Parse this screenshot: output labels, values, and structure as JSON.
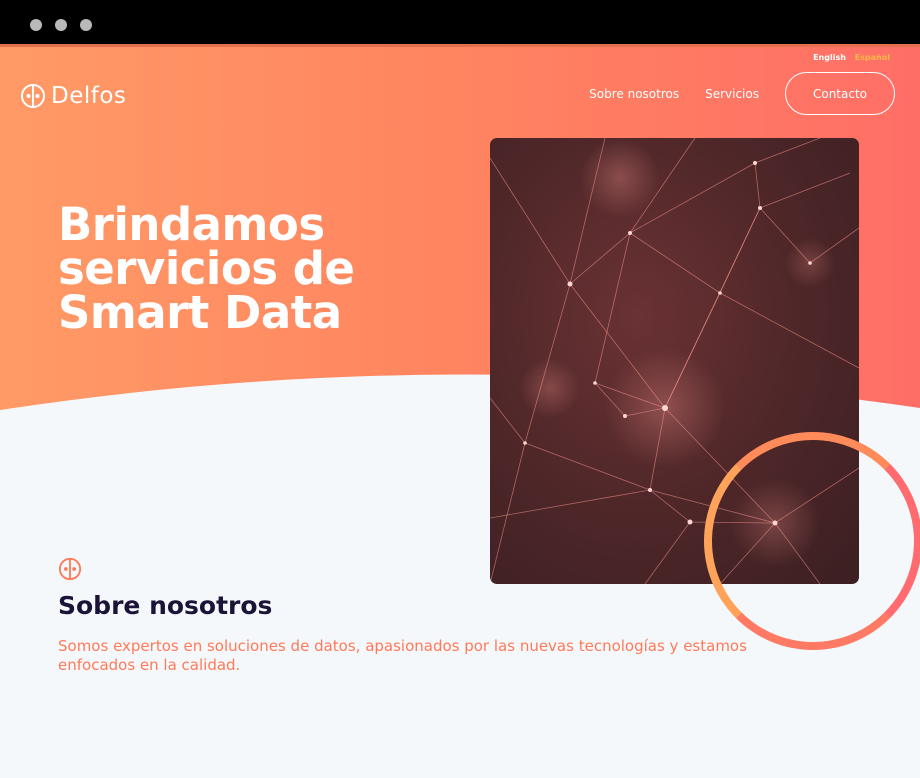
{
  "window": {
    "controls": [
      "close",
      "minimize",
      "maximize"
    ]
  },
  "language": {
    "english": "English",
    "spanish": "Español"
  },
  "brand": {
    "name": "Delfos",
    "logo_icon": "delfos-logo-icon"
  },
  "nav": {
    "links": [
      {
        "label": "Sobre nosotros"
      },
      {
        "label": "Servicios"
      }
    ],
    "contact_button": "Contacto"
  },
  "hero": {
    "headline_lines": [
      "Brindamos",
      "servicios de",
      "Smart Data"
    ],
    "image": "network-graph-image",
    "colors": {
      "gradient_start": "#ff9a66",
      "gradient_end": "#ff6e66"
    }
  },
  "about": {
    "icon": "delfos-logo-icon",
    "title": "Sobre nosotros",
    "text": "Somos expertos en soluciones de datos, apasionados por las nuevas tecnologías y estamos enfocados en la calidad."
  },
  "colors": {
    "accent": "#ff7a59",
    "title": "#1b1438",
    "background": "#f5f8fb"
  }
}
